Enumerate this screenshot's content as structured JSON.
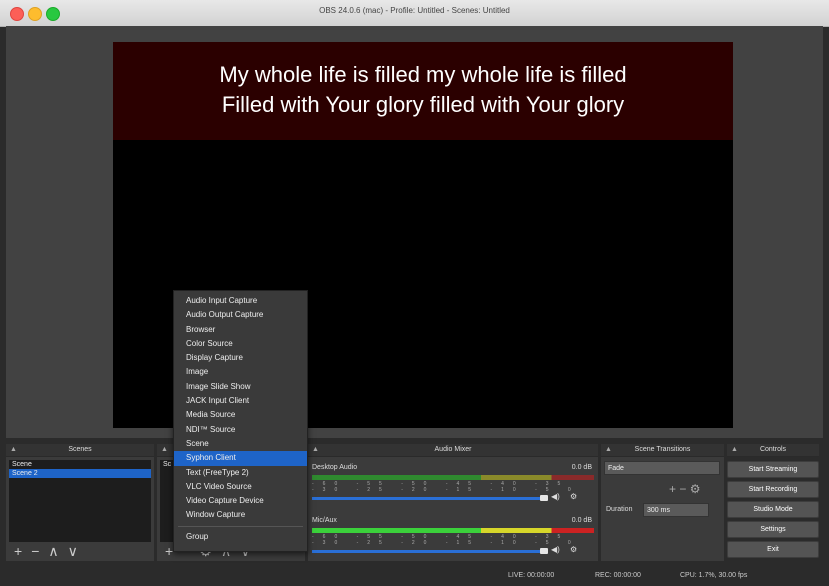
{
  "window": {
    "title": "OBS 24.0.6 (mac) - Profile: Untitled - Scenes: Untitled"
  },
  "preview": {
    "line1": "My whole life is filled my whole life is filled",
    "line2": "Filled with Your glory filled with Your glory"
  },
  "scenes": {
    "title": "Scenes",
    "items": [
      {
        "label": "Scene"
      },
      {
        "label": "Scene 2",
        "selected": true
      }
    ],
    "add": "+",
    "remove": "−",
    "up": "∧",
    "down": "∨"
  },
  "sources": {
    "title_abbrev": "Sc",
    "add": "+",
    "remove": "−",
    "settings": "⚙",
    "up": "∧",
    "down": "∨"
  },
  "add_source_menu": {
    "items": [
      "Audio Input Capture",
      "Audio Output Capture",
      "Browser",
      "Color Source",
      "Display Capture",
      "Image",
      "Image Slide Show",
      "JACK Input Client",
      "Media Source",
      "NDI™ Source",
      "Scene",
      "Syphon Client",
      "Text (FreeType 2)",
      "VLC Video Source",
      "Video Capture Device",
      "Window Capture"
    ],
    "selected_index": 11,
    "group": "Group"
  },
  "audio_mixer": {
    "title": "Audio Mixer",
    "channels": [
      {
        "name": "Desktop Audio",
        "db": "0.0 dB",
        "volume": 0.88
      },
      {
        "name": "Mic/Aux",
        "db": "0.0 dB",
        "volume": 0.88
      }
    ],
    "tick_labels": "-60 -55 -50 -45 -40 -35 -30 -25 -20 -15 -10 -5 0"
  },
  "transitions": {
    "title": "Scene Transitions",
    "selected": "Fade",
    "duration_label": "Duration",
    "duration_value": "300 ms",
    "add": "+",
    "remove": "−"
  },
  "controls": {
    "title": "Controls",
    "buttons": [
      "Start Streaming",
      "Start Recording",
      "Studio Mode",
      "Settings",
      "Exit"
    ]
  },
  "status": {
    "live": "LIVE: 00:00:00",
    "rec": "REC: 00:00:00",
    "cpu": "CPU: 1.7%, 30.00 fps"
  },
  "colors": {
    "accent": "#1e64c8"
  }
}
